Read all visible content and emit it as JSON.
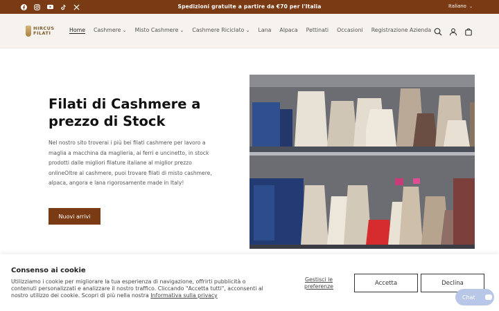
{
  "announcement": {
    "text": "Spedizioni gratuite a partire da €70 per l'Italia",
    "language": "Italiano",
    "social_icons": [
      "facebook-icon",
      "instagram-icon",
      "youtube-icon",
      "tiktok-icon",
      "x-icon"
    ]
  },
  "header": {
    "logo_line1": "HIRCUS",
    "logo_line2": "FILATI",
    "nav": [
      {
        "label": "Home",
        "active": true,
        "dropdown": false
      },
      {
        "label": "Cashmere",
        "active": false,
        "dropdown": true
      },
      {
        "label": "Misto Cashmere",
        "active": false,
        "dropdown": true
      },
      {
        "label": "Cashmere Riciclato",
        "active": false,
        "dropdown": true
      },
      {
        "label": "Lana",
        "active": false,
        "dropdown": false
      },
      {
        "label": "Alpaca",
        "active": false,
        "dropdown": false
      },
      {
        "label": "Pettinati",
        "active": false,
        "dropdown": false
      },
      {
        "label": "Occasioni",
        "active": false,
        "dropdown": false
      },
      {
        "label": "Registrazione Azienda",
        "active": false,
        "dropdown": false
      }
    ],
    "icons": [
      "search-icon",
      "account-icon",
      "cart-icon"
    ]
  },
  "hero": {
    "title": "Filati di Cashmere a prezzo di Stock",
    "text": "Nel nostro sito troverai i più bei filati cashmere per lavoro a maglia a macchina da maglieria, ai ferri e uncinetto, in stock prodotti dalle migliori filature italiane al miglior prezzo onlineOltre al cashmere, puoi trovare filati di misto cashmere, alpaca, angora e lana rigorosamente made in Italy!",
    "button": "Nuovi arrivi"
  },
  "cookie": {
    "title": "Consenso ai cookie",
    "text": "Utilizziamo i cookie per migliorare la tua esperienza di navigazione, offrirti pubblicità o contenuti personalizzati e analizzare il nostro traffico. Cliccando \"Accetta tutti\", acconsenti al nostro utilizzo dei cookie. Scopri di più nella nostra ",
    "link": "Informativa sulla privacy",
    "manage": "Gestisci le preferenze",
    "accept": "Accetta",
    "decline": "Declina"
  },
  "chat": {
    "label": "Chat"
  },
  "colors": {
    "brand": "#7a3a14",
    "header_bg": "#f6f3ee",
    "chat": "#b8c7e8"
  }
}
